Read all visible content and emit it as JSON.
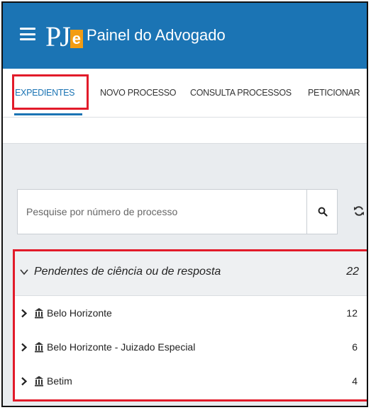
{
  "header": {
    "logo_text": "PJe",
    "logo_pj": "PJ",
    "logo_e": "e",
    "title": "Painel do Advogado"
  },
  "tabs": [
    {
      "label": "EXPEDIENTES",
      "active": true
    },
    {
      "label": "NOVO PROCESSO",
      "active": false
    },
    {
      "label": "CONSULTA PROCESSOS",
      "active": false
    },
    {
      "label": "PETICIONAR",
      "active": false
    }
  ],
  "search": {
    "placeholder": "Pesquise por número de processo",
    "value": ""
  },
  "icons": {
    "menu": "hamburger-icon",
    "search": "search-icon",
    "refresh": "refresh-icon",
    "expand": "chevron-down-icon",
    "row_arrow": "chevron-right-icon",
    "court": "bank-icon"
  },
  "panel": {
    "title": "Pendentes de ciência ou de resposta",
    "count": "22",
    "items": [
      {
        "label": "Belo Horizonte",
        "count": "12"
      },
      {
        "label": "Belo Horizonte - Juizado Especial",
        "count": "6"
      },
      {
        "label": "Betim",
        "count": "4"
      }
    ]
  },
  "colors": {
    "header": "#1b74b4",
    "accent": "#1b74b4",
    "logo_e": "#f39c12",
    "highlight": "#e21b2a"
  }
}
